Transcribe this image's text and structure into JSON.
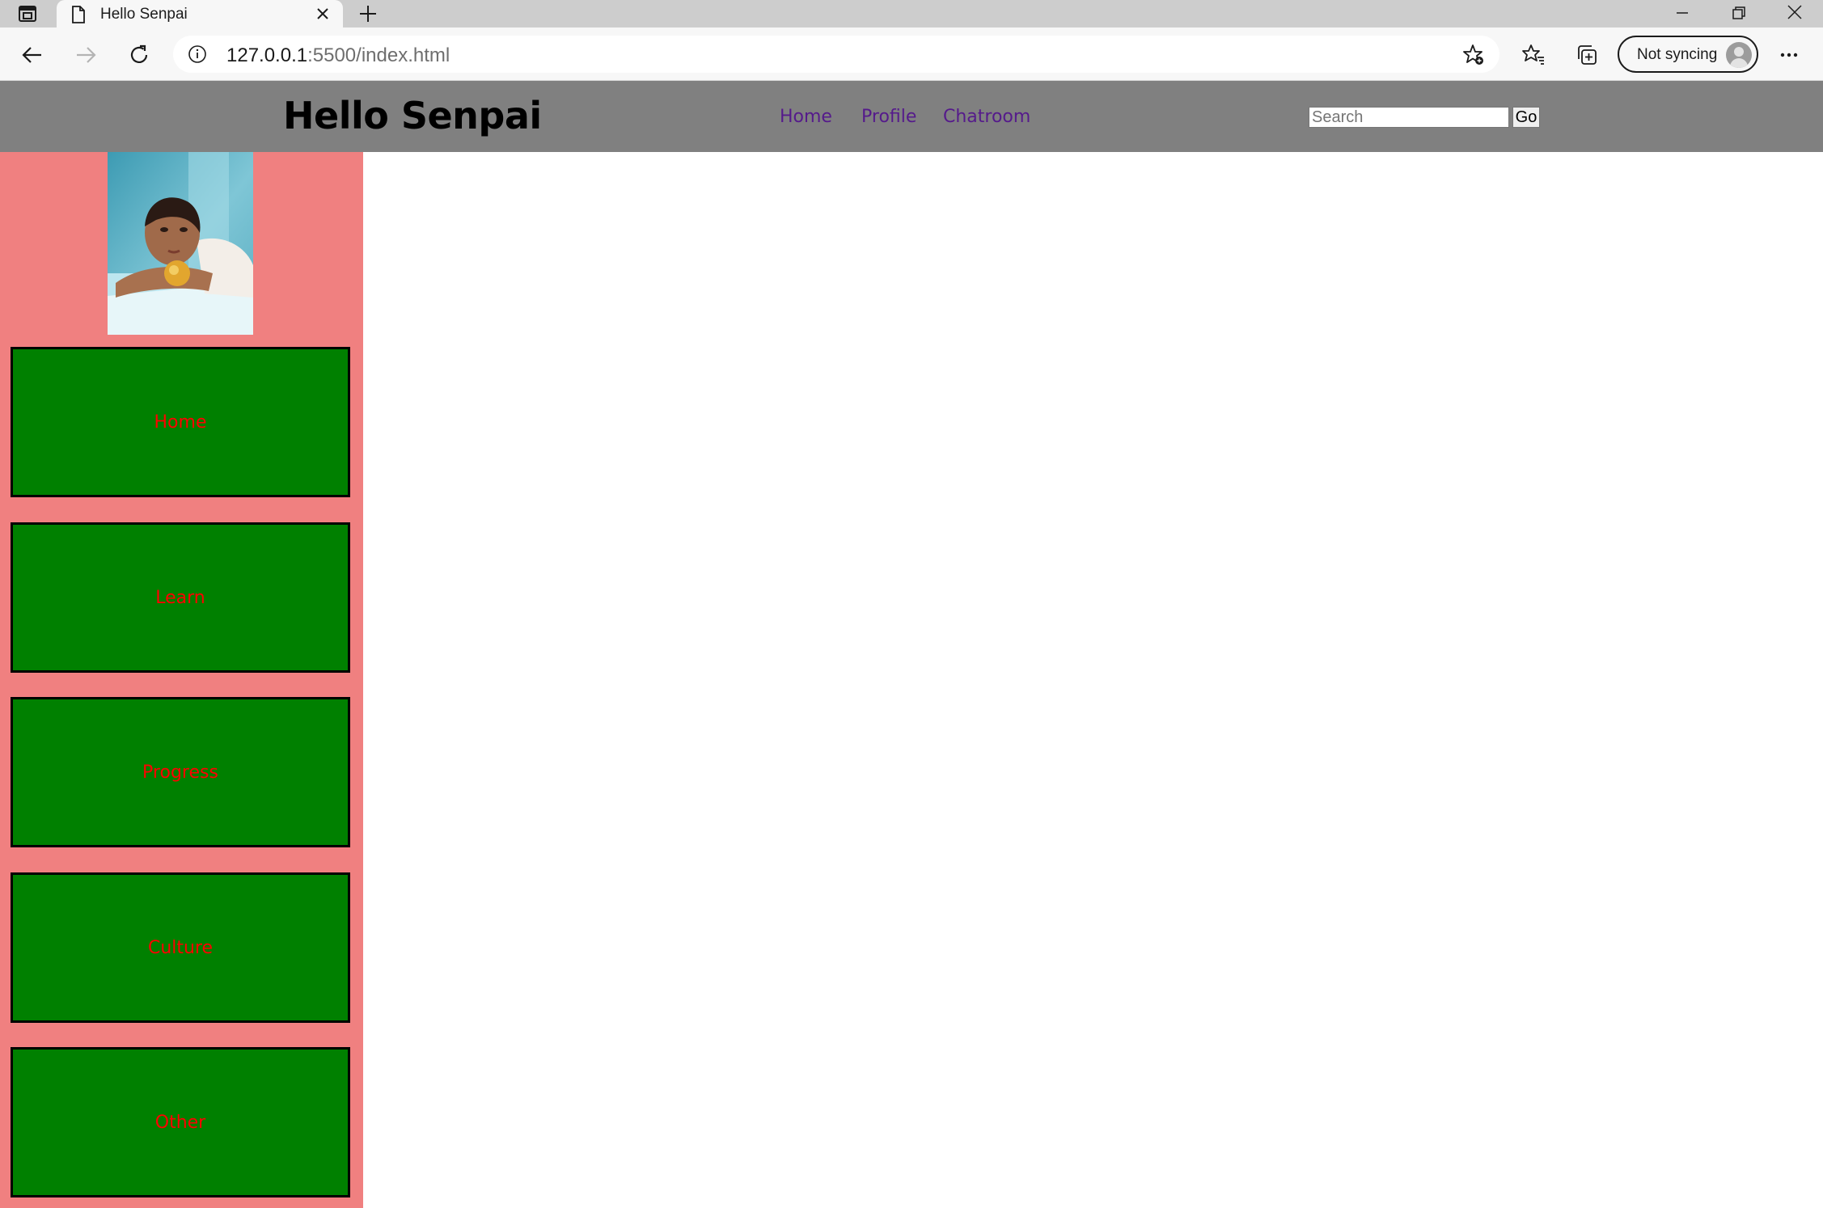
{
  "browser": {
    "tab_title": "Hello Senpai",
    "url_host": "127.0.0.1",
    "url_rest": ":5500/index.html",
    "profile_label": "Not syncing"
  },
  "header": {
    "title": "Hello Senpai",
    "nav": [
      {
        "label": "Home"
      },
      {
        "label": "Profile"
      },
      {
        "label": "Chatroom"
      }
    ],
    "search_placeholder": "Search",
    "go_label": "Go"
  },
  "sidebar": {
    "photo_alt": "profile photo",
    "items": [
      {
        "label": "Home"
      },
      {
        "label": "Learn"
      },
      {
        "label": "Progress"
      },
      {
        "label": "Culture"
      },
      {
        "label": "Other"
      }
    ]
  },
  "colors": {
    "header_bg": "#808080",
    "sidebar_bg": "#f08080",
    "button_bg": "#008000",
    "button_text": "#ff0000",
    "nav_link": "#551a8b"
  }
}
